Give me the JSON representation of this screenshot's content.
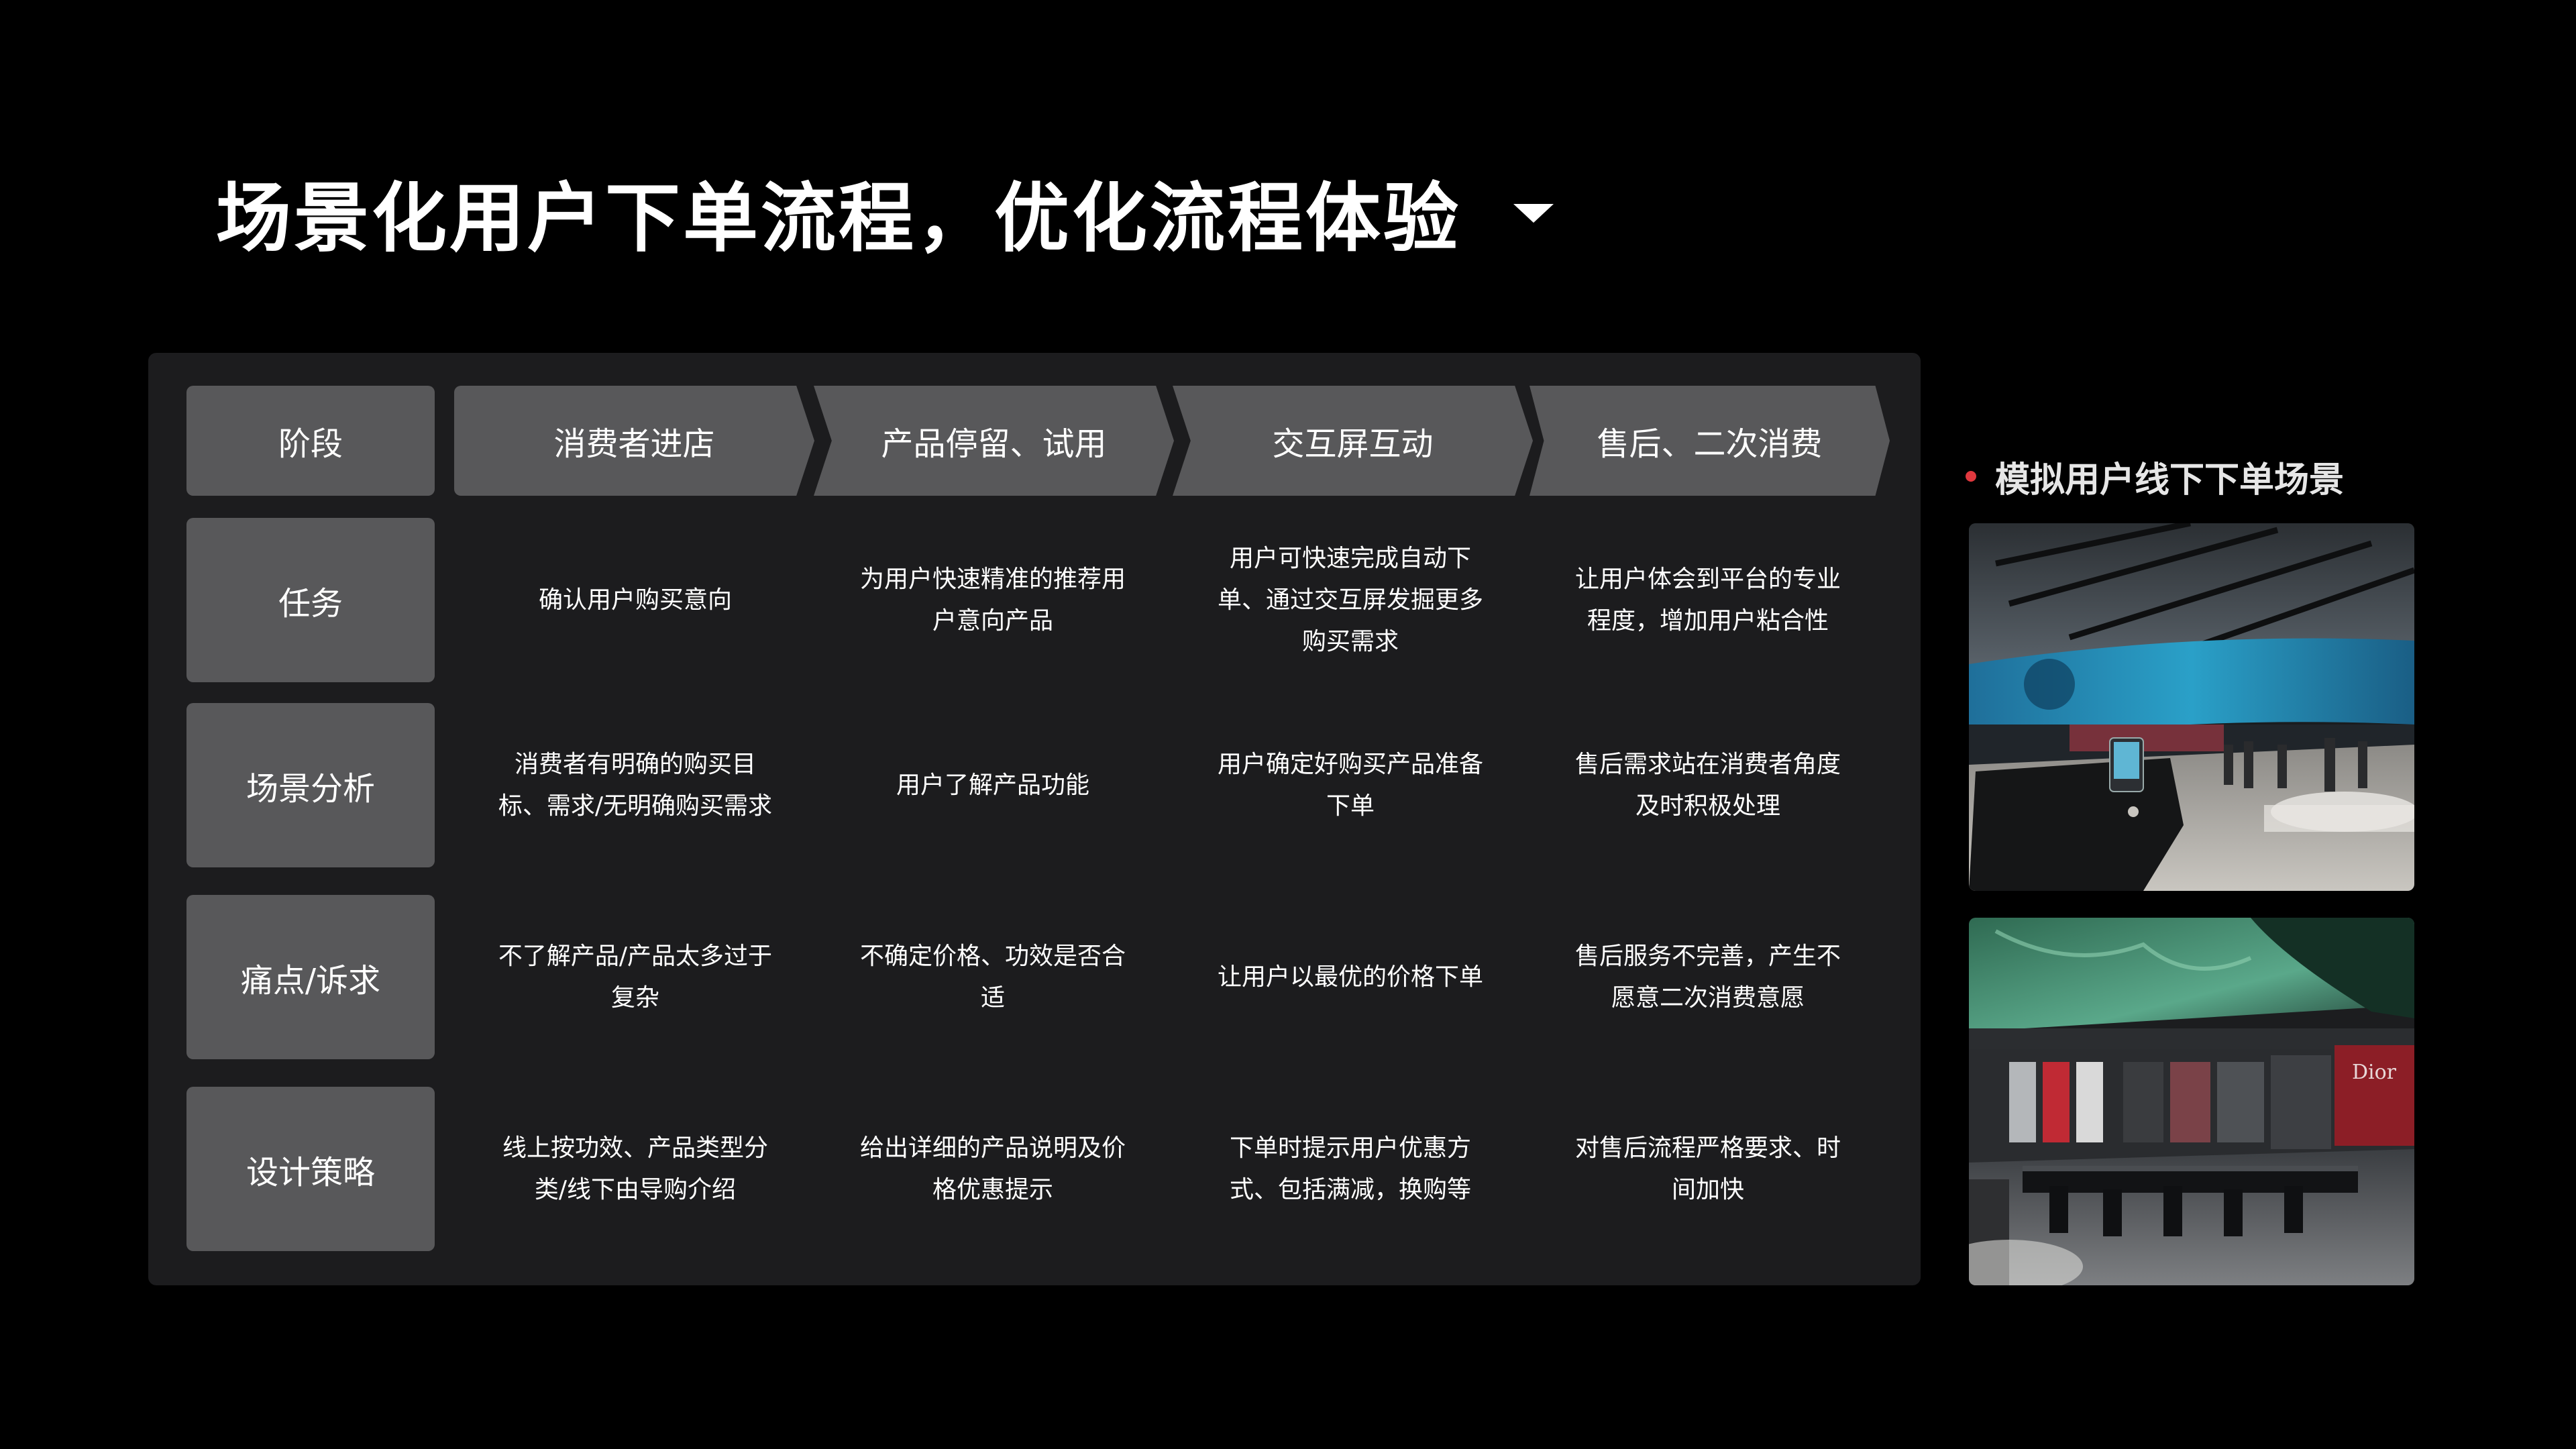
{
  "title": "场景化用户下单流程，优化流程体验",
  "table": {
    "stage_header": "阶段",
    "stages": [
      "消费者进店",
      "产品停留、试用",
      "交互屏互动",
      "售后、二次消费"
    ],
    "rows": [
      {
        "label": "任务",
        "cells": [
          [
            "确认用户购买意向"
          ],
          [
            "为用户快速精准的推荐用",
            "户意向产品"
          ],
          [
            "用户可快速完成自动下",
            "单、通过交互屏发掘更多",
            "购买需求"
          ],
          [
            "让用户体会到平台的专业",
            "程度，增加用户粘合性"
          ]
        ]
      },
      {
        "label": "场景分析",
        "cells": [
          [
            "消费者有明确的购买目",
            "标、需求/无明确购买需求"
          ],
          [
            "用户了解产品功能"
          ],
          [
            "用户确定好购买产品准备",
            "下单"
          ],
          [
            "售后需求站在消费者角度",
            "及时积极处理"
          ]
        ]
      },
      {
        "label": "痛点/诉求",
        "cells": [
          [
            "不了解产品/产品太多过于",
            "复杂"
          ],
          [
            "不确定价格、功效是否合",
            "适"
          ],
          [
            "让用户以最优的价格下单"
          ],
          [
            "售后服务不完善，产生不",
            "愿意二次消费意愿"
          ]
        ]
      },
      {
        "label": "设计策略",
        "cells": [
          [
            "线上按功效、产品类型分",
            "类/线下由导购介绍"
          ],
          [
            "给出详细的产品说明及价",
            "格优惠提示"
          ],
          [
            "下单时提示用户优惠方",
            "式、包括满减，换购等"
          ],
          [
            "对售后流程严格要求、时",
            "间加快"
          ]
        ]
      }
    ]
  },
  "side": {
    "heading": "模拟用户线下下单场景",
    "photos": [
      {
        "name": "store-photo-ocean-ceiling"
      },
      {
        "name": "store-photo-forest-ceiling",
        "sign": "Dior"
      }
    ]
  },
  "colors": {
    "background": "#000000",
    "panel": "#1c1c1e",
    "label_fill": "#58585a",
    "accent_dot": "#e0383e"
  },
  "icons": [
    "dropdown-caret-icon",
    "bullet-dot-icon"
  ]
}
